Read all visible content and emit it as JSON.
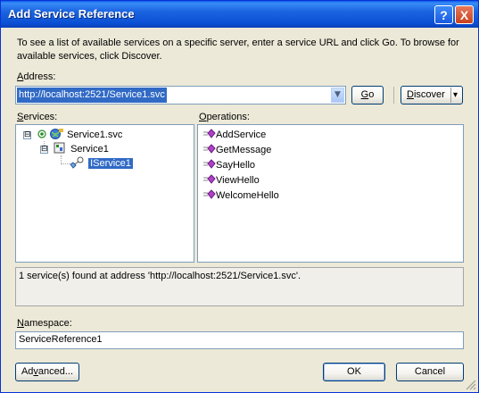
{
  "window": {
    "title": "Add Service Reference",
    "help_glyph": "?",
    "close_glyph": "X"
  },
  "description": "To see a list of available services on a specific server, enter a service URL and click Go. To browse for available services, click Discover.",
  "address": {
    "label_access": "A",
    "label_rest": "ddress:",
    "value": "http://localhost:2521/Service1.svc",
    "dropdown_glyph": "▼"
  },
  "go_button": {
    "access": "G",
    "rest": "o"
  },
  "discover_button": {
    "access": "D",
    "rest": "iscover",
    "arrow": "▾"
  },
  "services": {
    "label_access": "S",
    "label_rest": "ervices:",
    "tree": [
      {
        "label": "Service1.svc",
        "expanded": "⊟"
      },
      {
        "label": "Service1",
        "expanded": "⊟"
      },
      {
        "label": "IService1",
        "selected": true
      }
    ]
  },
  "operations": {
    "label_access": "O",
    "label_rest": "perations:",
    "items": [
      "AddService",
      "GetMessage",
      "SayHello",
      "ViewHello",
      "WelcomeHello"
    ]
  },
  "status_text": "1 service(s) found at address 'http://localhost:2521/Service1.svc'.",
  "namespace": {
    "label_access": "N",
    "label_rest": "amespace:",
    "value": "ServiceReference1"
  },
  "advanced_button": {
    "pre": "Ad",
    "access": "v",
    "rest": "anced..."
  },
  "ok_button": "OK",
  "cancel_button": "Cancel",
  "colors": {
    "selection": "#316ac5",
    "titlebar": "#0a5ee8",
    "dialog_bg": "#ece9d8",
    "field_border": "#7f9db9"
  },
  "icons": [
    "help-icon",
    "close-icon",
    "dropdown-arrow-icon",
    "service-globe-icon",
    "service-class-icon",
    "interface-icon",
    "method-icon",
    "resize-grip-icon"
  ]
}
